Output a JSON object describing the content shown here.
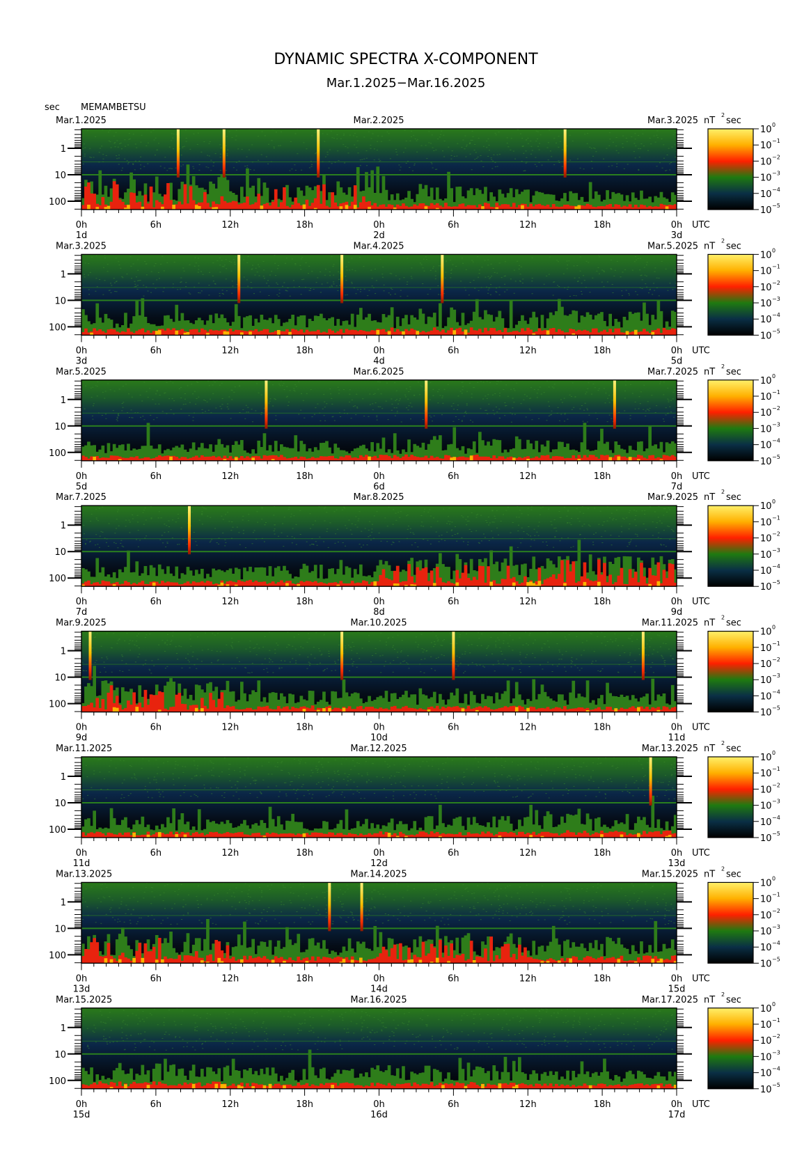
{
  "chart_data": {
    "type": "heatmap",
    "title": "DYNAMIC SPECTRA X-COMPONENT",
    "subtitle": "Mar.1.2025−Mar.16.2025",
    "station": "MEMAMBETSU",
    "y_unit": "sec",
    "colorbar_unit": "nT",
    "colorbar_unit_sup": "2",
    "colorbar_unit_suffix": "sec",
    "y_scale": "log",
    "y_ticks": [
      "1",
      "10",
      "100"
    ],
    "x_ticks": [
      "0h",
      "6h",
      "12h",
      "18h",
      "0h",
      "6h",
      "12h",
      "18h",
      "0h"
    ],
    "x_unit": "UTC",
    "colorbar_ticks": [
      {
        "base": "10",
        "exp": "0"
      },
      {
        "base": "10",
        "exp": "−1"
      },
      {
        "base": "10",
        "exp": "−2"
      },
      {
        "base": "10",
        "exp": "−3"
      },
      {
        "base": "10",
        "exp": "−4"
      },
      {
        "base": "10",
        "exp": "−5"
      }
    ],
    "colormap": [
      "#fff06a",
      "#ffb000",
      "#ff2000",
      "#1f7a10",
      "#0a2f45",
      "#000000"
    ],
    "panels": [
      {
        "date_left": "Mar.1.2025",
        "date_mid": "Mar.2.2025",
        "date_right": "Mar.3.2025",
        "day_left": "1d",
        "day_mid": "2d",
        "day_right": "3d",
        "spikes_hours": [
          7.8,
          11.5,
          19.1,
          39.0
        ],
        "activity": [
          0.85,
          0.7,
          0.5,
          0.4
        ]
      },
      {
        "date_left": "Mar.3.2025",
        "date_mid": "Mar.4.2025",
        "date_right": "Mar.5.2025",
        "day_left": "3d",
        "day_mid": "4d",
        "day_right": "5d",
        "spikes_hours": [
          12.7,
          21.0,
          29.1
        ],
        "activity": [
          0.5,
          0.45,
          0.6,
          0.55
        ]
      },
      {
        "date_left": "Mar.5.2025",
        "date_mid": "Mar.6.2025",
        "date_right": "Mar.7.2025",
        "day_left": "5d",
        "day_mid": "6d",
        "day_right": "7d",
        "spikes_hours": [
          14.9,
          27.8,
          43.0
        ],
        "activity": [
          0.35,
          0.4,
          0.45,
          0.4
        ]
      },
      {
        "date_left": "Mar.7.2025",
        "date_mid": "Mar.8.2025",
        "date_right": "Mar.9.2025",
        "day_left": "7d",
        "day_mid": "8d",
        "day_right": "9d",
        "spikes_hours": [
          8.7
        ],
        "activity": [
          0.4,
          0.45,
          0.65,
          0.7
        ]
      },
      {
        "date_left": "Mar.9.2025",
        "date_mid": "Mar.10.2025",
        "date_right": "Mar.11.2025",
        "day_left": "9d",
        "day_mid": "10d",
        "day_right": "11d",
        "spikes_hours": [
          0.7,
          21.0,
          30.0,
          45.3
        ],
        "activity": [
          0.75,
          0.45,
          0.45,
          0.4
        ]
      },
      {
        "date_left": "Mar.11.2025",
        "date_mid": "Mar.12.2025",
        "date_right": "Mar.13.2025",
        "day_left": "11d",
        "day_mid": "12d",
        "day_right": "13d",
        "spikes_hours": [
          45.9
        ],
        "activity": [
          0.4,
          0.35,
          0.45,
          0.55
        ]
      },
      {
        "date_left": "Mar.13.2025",
        "date_mid": "Mar.14.2025",
        "date_right": "Mar.15.2025",
        "day_left": "13d",
        "day_mid": "14d",
        "day_right": "15d",
        "spikes_hours": [
          20.0,
          22.6
        ],
        "activity": [
          0.7,
          0.55,
          0.65,
          0.6
        ]
      },
      {
        "date_left": "Mar.15.2025",
        "date_mid": "Mar.16.2025",
        "date_right": "Mar.17.2025",
        "day_left": "15d",
        "day_mid": "16d",
        "day_right": "17d",
        "spikes_hours": [],
        "activity": [
          0.55,
          0.45,
          0.5,
          0.35
        ]
      }
    ]
  }
}
